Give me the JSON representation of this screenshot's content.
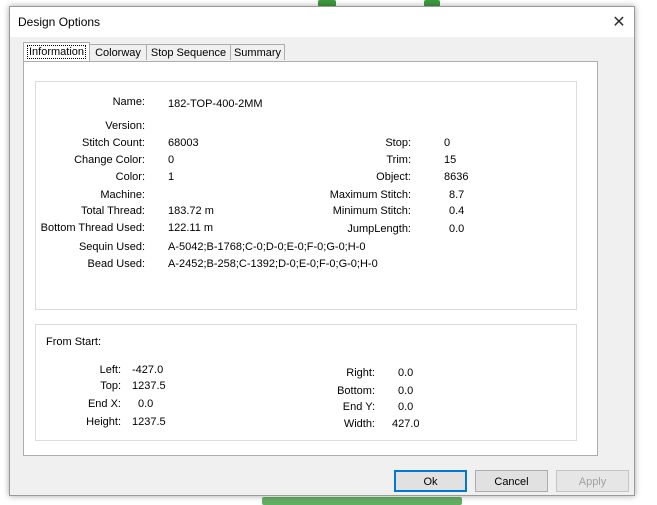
{
  "window": {
    "title": "Design Options",
    "close_glyph": "✕"
  },
  "tabs": [
    {
      "label": "Information",
      "active": true
    },
    {
      "label": "Colorway",
      "active": false
    },
    {
      "label": "Stop Sequence",
      "active": false
    },
    {
      "label": "Summary",
      "active": false
    }
  ],
  "info": {
    "name": {
      "label": "Name:",
      "value": "182-TOP-400-2MM"
    },
    "version": {
      "label": "Version:",
      "value": ""
    },
    "stitch_count": {
      "label": "Stitch Count:",
      "value": "68003"
    },
    "change_color": {
      "label": "Change Color:",
      "value": "0"
    },
    "color": {
      "label": "Color:",
      "value": "1"
    },
    "machine": {
      "label": "Machine:",
      "value": ""
    },
    "total_thread": {
      "label": "Total Thread:",
      "value": "183.72 m"
    },
    "bottom_thread": {
      "label": "Bottom Thread Used:",
      "value": "122.11 m"
    },
    "sequin": {
      "label": "Sequin Used:",
      "value": "A-5042;B-1768;C-0;D-0;E-0;F-0;G-0;H-0"
    },
    "bead": {
      "label": "Bead Used:",
      "value": "A-2452;B-258;C-1392;D-0;E-0;F-0;G-0;H-0"
    },
    "stop": {
      "label": "Stop:",
      "value": "0"
    },
    "trim": {
      "label": "Trim:",
      "value": "15"
    },
    "object": {
      "label": "Object:",
      "value": "8636"
    },
    "max_stitch": {
      "label": "Maximum Stitch:",
      "value": "8.7"
    },
    "min_stitch": {
      "label": "Minimum Stitch:",
      "value": "0.4"
    },
    "jump_length": {
      "label": "JumpLength:",
      "value": "0.0"
    }
  },
  "from_start": {
    "heading": "From Start:",
    "left": {
      "label": "Left:",
      "value": "-427.0"
    },
    "top": {
      "label": "Top:",
      "value": "1237.5"
    },
    "end_x": {
      "label": "End X:",
      "value": "0.0"
    },
    "height": {
      "label": "Height:",
      "value": "1237.5"
    },
    "right": {
      "label": "Right:",
      "value": "0.0"
    },
    "bottom": {
      "label": "Bottom:",
      "value": "0.0"
    },
    "end_y": {
      "label": "End Y:",
      "value": "0.0"
    },
    "width": {
      "label": "Width:",
      "value": "427.0"
    }
  },
  "buttons": {
    "ok": "Ok",
    "cancel": "Cancel",
    "apply": "Apply"
  }
}
